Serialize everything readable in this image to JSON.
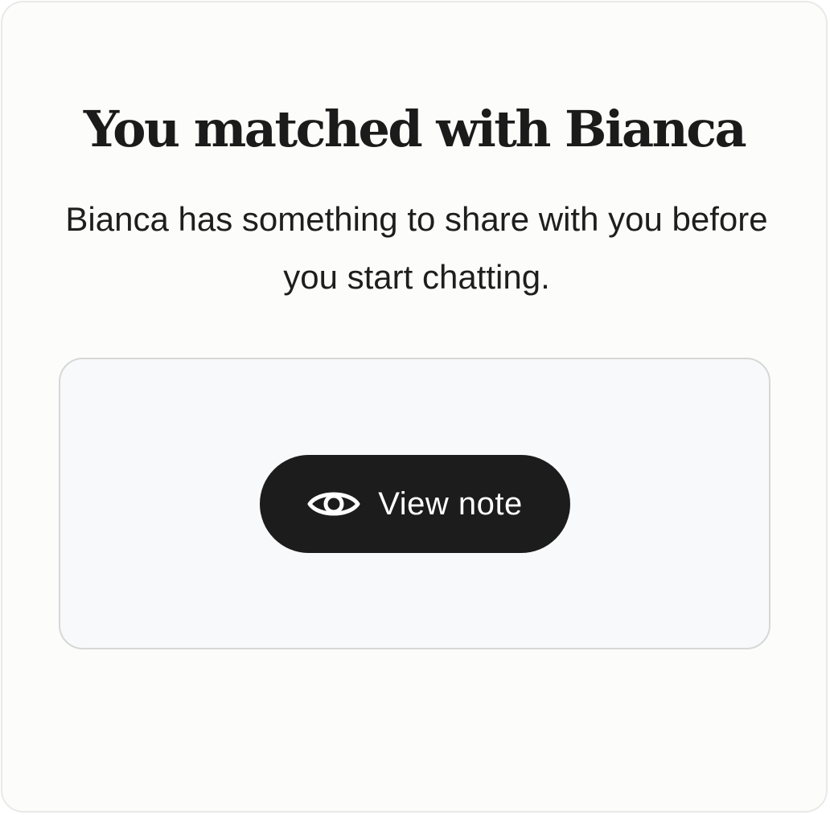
{
  "match": {
    "title": "You matched with Bianca",
    "subtitle": "Bianca has something to share with you before you start chatting."
  },
  "note": {
    "hidden_text": "",
    "view_button_label": "View note",
    "view_icon": "eye-icon"
  },
  "colors": {
    "background": "#fcfcfa",
    "button": "#1c1c1c",
    "button_text": "#ffffff",
    "note_card_bg": "#f8f9fa"
  }
}
